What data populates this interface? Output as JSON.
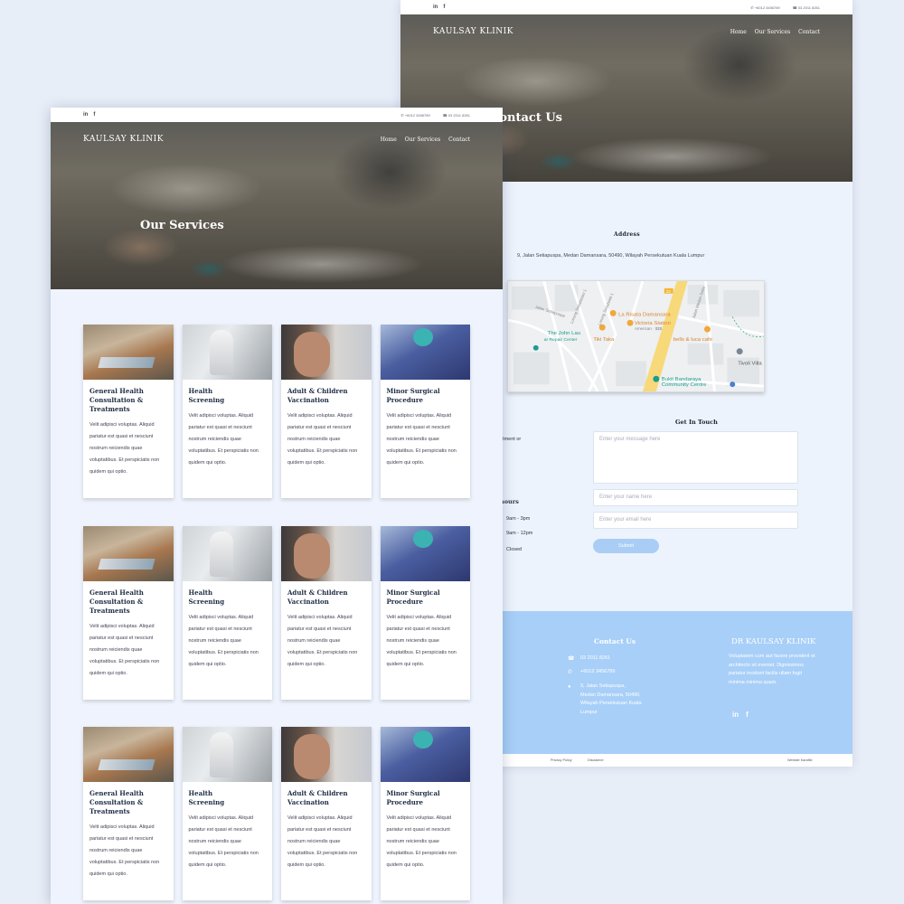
{
  "contact_page": {
    "topbar": {
      "phone_whatsapp": "+6012 3456789",
      "phone": "03 2011 8261"
    },
    "brand": "KAULSAY KLINIK",
    "nav": [
      "Home",
      "Our Services",
      "Contact"
    ],
    "hero_title": "Contact Us",
    "address_title": "Address",
    "address_text": "9, Jalan Setiapuspa, Medan Damansara, 50490,  Wilayah Persekutuan Kuala Lumpur",
    "map_labels": {
      "la_risata": "La Risata Damansara",
      "victoria": "Victoria Station",
      "victoria_sub": "American · $$$",
      "tiki": "Tiki Taka",
      "bells": "bells & luca cafe",
      "john_lau": "The John Lau",
      "john_lau_sub": "ar Repair Center",
      "tivoli": "Tivoli Villa",
      "bukit": "Bukit Bandaraya",
      "bukit_sub": "Community Centre",
      "road_badge": "23",
      "street1": "Jalan Setiapuspa",
      "street2": "Lorong Setiabistari 1",
      "street3": "Lorong Setiabakti 1",
      "street4": "Jalan Medan Setia"
    },
    "form": {
      "title": "Get In Touch",
      "message_placeholder": "Enter your message here",
      "name_placeholder": "Enter your name here",
      "email_placeholder": "Enter your email here",
      "submit": "Submit"
    },
    "partial_text": {
      "appointment": "ntment or",
      "hours_title": "hours",
      "hours_1": "9am - 3pm",
      "hours_2": "9am - 12pm",
      "hours_3": "Closed"
    },
    "footer": {
      "contact_title": "Contact Us",
      "phone": "03 2011 8261",
      "whatsapp": "+6012 3456789",
      "address_lines": [
        "9, Jalan Setiapuspa,",
        "Medan Damansara, 50490,",
        "Wilayah Persekutuan Kuala",
        "Lumpur"
      ],
      "brand_title": "DR KAULSAY KLINIK",
      "blurb": "Voluptatem cum aut facere provident et architecto sit eveniet. Dignissimos pariatur incidunt facilis ullam fugit minima minima quam."
    },
    "bottom_links": [
      "Privacy Policy",
      "Disclaimer",
      "Website Karafile"
    ]
  },
  "services_page": {
    "brand": "KAULSAY KLINIK",
    "nav": [
      "Home",
      "Our Services",
      "Contact"
    ],
    "hero_title": "Our Services",
    "topbar": {
      "phone_whatsapp": "+6012 3456789",
      "phone": "03 2011 8261"
    },
    "services": [
      {
        "title": "General Health Consultation & Treatments",
        "desc": "Velit adipisci voluptas. Aliquid pariatur est quasi et nesciunt nostrum reiciendis quae voluptatibus. Et perspiciatis non quidem qui optio."
      },
      {
        "title": "Health Screening",
        "desc": "Velit adipisci voluptas. Aliquid pariatur est quasi et nesciunt nostrum reiciendis quae voluptatibus. Et perspiciatis non quidem qui optio."
      },
      {
        "title": "Adult & Children Vaccination",
        "desc": "Velit adipisci voluptas. Aliquid pariatur est quasi et nesciunt nostrum reiciendis quae voluptatibus. Et perspiciatis non quidem qui optio."
      },
      {
        "title": "Minor Surgical Procedure",
        "desc": "Velit adipisci voluptas. Aliquid pariatur est quasi et nesciunt nostrum reiciendis quae voluptatibus. Et perspiciatis non quidem qui optio."
      }
    ]
  },
  "colors": {
    "accent": "#a8cff8",
    "page_bg": "#eef3fd",
    "heading": "#1f2d45"
  },
  "icons": {
    "linkedin": "linkedin-icon",
    "facebook": "facebook-icon",
    "whatsapp": "whatsapp-icon",
    "phone": "phone-icon",
    "location": "location-pin-icon"
  }
}
